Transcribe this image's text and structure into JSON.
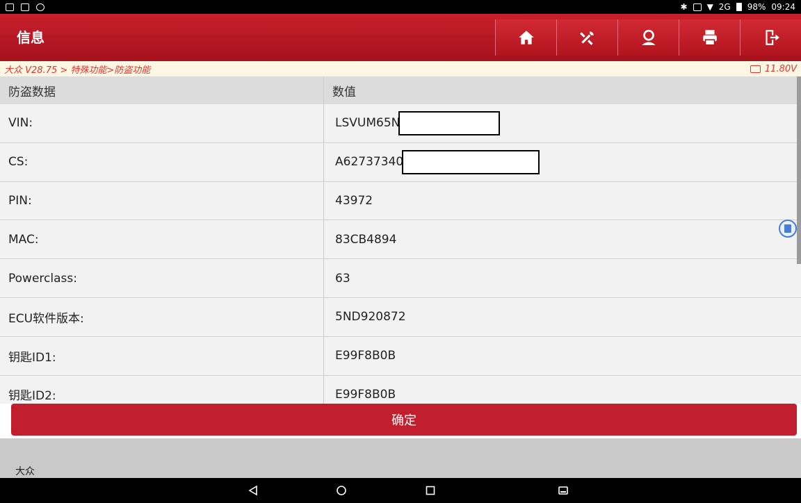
{
  "status_bar": {
    "battery": "98%",
    "time": "09:24",
    "network": "2G"
  },
  "header": {
    "title": "信息",
    "toolbar": [
      "home-icon",
      "diagnose-icon",
      "user-icon",
      "print-icon",
      "exit-icon"
    ]
  },
  "breadcrumb": {
    "path": "大众 V28.75 > 特殊功能>防盗功能",
    "voltage": "11.80V"
  },
  "table": {
    "headers": [
      "防盗数据",
      "数值"
    ],
    "rows": [
      {
        "label": "VIN:",
        "value": "LSVUM65N"
      },
      {
        "label": "CS:",
        "value": "A62737340"
      },
      {
        "label": "PIN:",
        "value": "43972"
      },
      {
        "label": "MAC:",
        "value": "83CB4894"
      },
      {
        "label": "Powerclass:",
        "value": "63"
      },
      {
        "label": "ECU软件版本:",
        "value": "5ND920872"
      },
      {
        "label": "钥匙ID1:",
        "value": "E99F8B0B"
      },
      {
        "label": "钥匙ID2:",
        "value": "E99F8B0B"
      }
    ]
  },
  "confirm_label": "确定",
  "footer": {
    "brand": "大众"
  },
  "colors": {
    "header": "#b5161f",
    "accent": "#c21f2e",
    "breadcrumb_text": "#e2342d"
  }
}
